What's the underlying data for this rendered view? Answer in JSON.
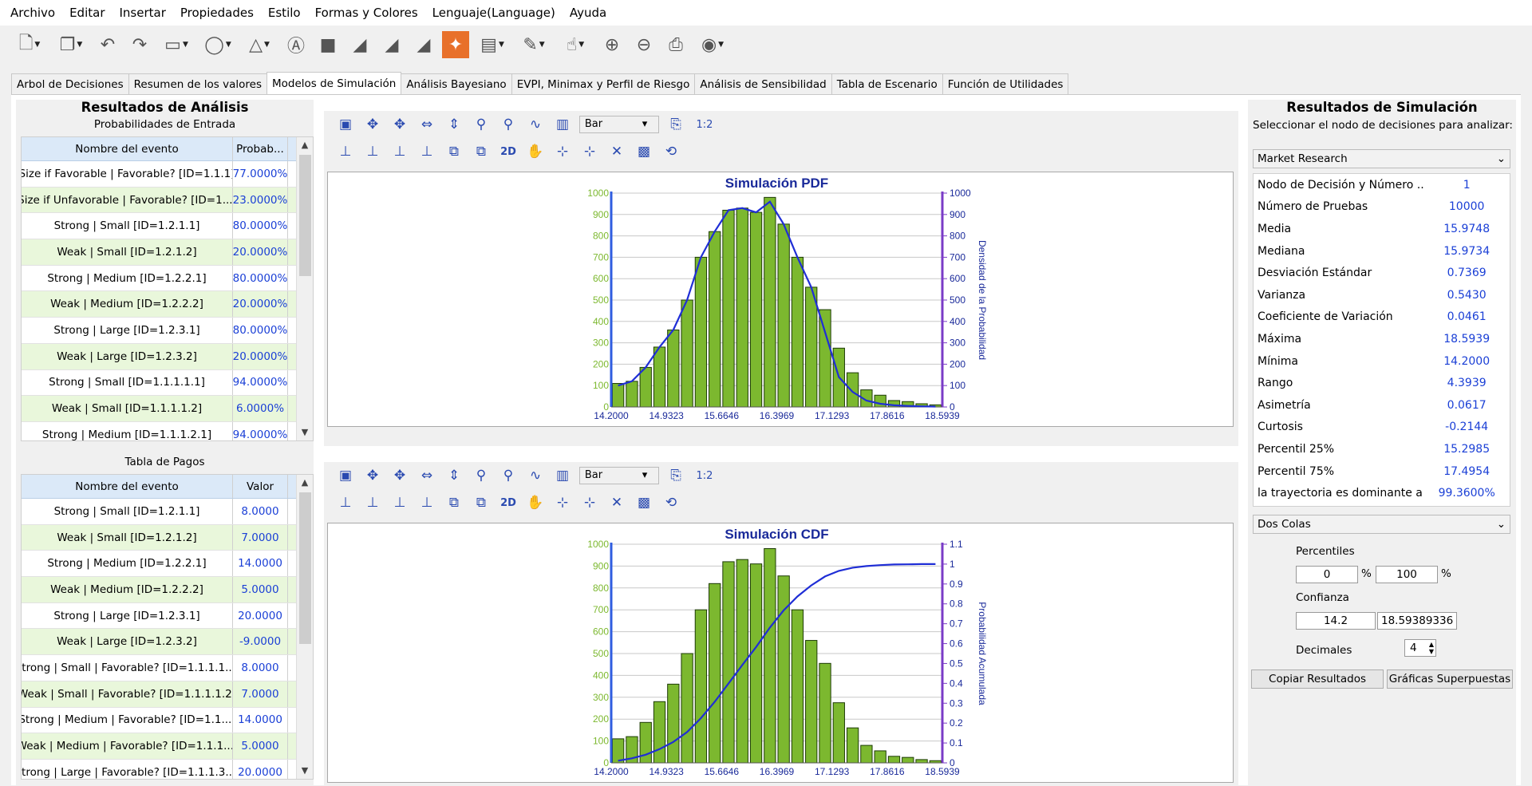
{
  "menu": [
    "Archivo",
    "Editar",
    "Insertar",
    "Propiedades",
    "Estilo",
    "Formas y Colores",
    "Lenguaje(Language)",
    "Ayuda"
  ],
  "toolbar_icons": [
    "new-file-icon",
    "copy-icon",
    "undo-icon",
    "redo-icon",
    "rectangle-icon",
    "ellipse-icon",
    "triangle-icon",
    "text-box-icon",
    "fill-icon",
    "chart-icon",
    "chart-icon",
    "chart-icon",
    "simulation-icon",
    "calculator-icon",
    "edit-icon",
    "pointer-icon",
    "zoom-in-icon",
    "zoom-out-icon",
    "print-icon",
    "palette-icon"
  ],
  "tabs": [
    "Arbol de Decisiones",
    "Resumen de los valores",
    "Modelos de Simulación",
    "Análisis Bayesiano",
    "EVPI, Minimax y Perfil de Riesgo",
    "Análisis de Sensibilidad",
    "Tabla de Escenario",
    "Función de Utilidades"
  ],
  "active_tab": 2,
  "left": {
    "title": "Resultados de Análisis",
    "prob_title": "Probabilidades de Entrada",
    "prob_headers": [
      "Nombre del evento",
      "Probab..."
    ],
    "prob_rows": [
      [
        "Size if Favorable | Favorable? [ID=1.1.1]",
        "77.0000%"
      ],
      [
        "Size if Unfavorable | Favorable? [ID=1....",
        "23.0000%"
      ],
      [
        "Strong | Small [ID=1.2.1.1]",
        "80.0000%"
      ],
      [
        "Weak | Small [ID=1.2.1.2]",
        "20.0000%"
      ],
      [
        "Strong | Medium [ID=1.2.2.1]",
        "80.0000%"
      ],
      [
        "Weak | Medium [ID=1.2.2.2]",
        "20.0000%"
      ],
      [
        "Strong | Large [ID=1.2.3.1]",
        "80.0000%"
      ],
      [
        "Weak | Large [ID=1.2.3.2]",
        "20.0000%"
      ],
      [
        "Strong | Small [ID=1.1.1.1.1]",
        "94.0000%"
      ],
      [
        "Weak | Small [ID=1.1.1.1.2]",
        "6.0000%"
      ],
      [
        "Strong | Medium [ID=1.1.1.2.1]",
        "94.0000%"
      ]
    ],
    "pay_title": "Tabla de Pagos",
    "pay_headers": [
      "Nombre del evento",
      "Valor"
    ],
    "pay_rows": [
      [
        "Strong | Small [ID=1.2.1.1]",
        "8.0000"
      ],
      [
        "Weak | Small [ID=1.2.1.2]",
        "7.0000"
      ],
      [
        "Strong | Medium [ID=1.2.2.1]",
        "14.0000"
      ],
      [
        "Weak | Medium [ID=1.2.2.2]",
        "5.0000"
      ],
      [
        "Strong | Large [ID=1.2.3.1]",
        "20.0000"
      ],
      [
        "Weak | Large [ID=1.2.3.2]",
        "-9.0000"
      ],
      [
        "Strong | Small | Favorable? [ID=1.1.1.1....",
        "8.0000"
      ],
      [
        "Weak | Small | Favorable? [ID=1.1.1.1.2]",
        "7.0000"
      ],
      [
        "Strong | Medium | Favorable? [ID=1.1....",
        "14.0000"
      ],
      [
        "Weak | Medium | Favorable? [ID=1.1.1....",
        "5.0000"
      ],
      [
        "Strong | Large | Favorable? [ID=1.1.1.3....",
        "20.0000"
      ]
    ]
  },
  "chart_toolbar": {
    "type_select": "Bar",
    "mode_2d": "2D",
    "num_label": "1:2"
  },
  "right": {
    "title": "Resultados de Simulación",
    "prompt": "Seleccionar el nodo de decisiones para analizar:",
    "node_select": "Market Research",
    "stats": [
      [
        "Nodo de Decisión y Número ...",
        "1"
      ],
      [
        "Número de Pruebas",
        "10000"
      ],
      [
        "Media",
        "15.9748"
      ],
      [
        "Mediana",
        "15.9734"
      ],
      [
        "Desviación Estándar",
        "0.7369"
      ],
      [
        "Varianza",
        "0.5430"
      ],
      [
        "Coeficiente de Variación",
        "0.0461"
      ],
      [
        "Máxima",
        "18.5939"
      ],
      [
        "Mínima",
        "14.2000"
      ],
      [
        "Rango",
        "4.3939"
      ],
      [
        "Asimetría",
        "0.0617"
      ],
      [
        "Curtosis",
        "-0.2144"
      ],
      [
        "Percentil 25%",
        "15.2985"
      ],
      [
        "Percentil 75%",
        "17.4954"
      ],
      [
        "la trayectoria es dominante al...",
        "99.3600%"
      ]
    ],
    "tails_select": "Dos Colas",
    "percentiles_label": "Percentiles",
    "pct_low": "0",
    "pct_high": "100",
    "pct_sign": "%",
    "confianza_label": "Confianza",
    "conf_low": "14.2",
    "conf_high": "18.59389336",
    "decimales_label": "Decimales",
    "decimales": "4",
    "copy_button": "Copiar Resultados",
    "overlay_button": "Gráficas Superpuestas"
  },
  "chart_data": [
    {
      "type": "bar",
      "title": "Simulación PDF",
      "xlabel": "",
      "ylabel": "",
      "y2label": "Densidad de la Probabilidad",
      "x_ticks": [
        "14.2000",
        "14.9323",
        "15.6646",
        "16.3969",
        "17.1293",
        "17.8616",
        "18.5939"
      ],
      "y_ticks": [
        "0",
        "100",
        "200",
        "300",
        "400",
        "500",
        "600",
        "700",
        "800",
        "900",
        "1000"
      ],
      "y2_ticks": [
        "0",
        "100",
        "200",
        "300",
        "400",
        "500",
        "600",
        "700",
        "800",
        "900",
        "1000"
      ],
      "ylim": [
        0,
        1000
      ],
      "y2lim": [
        0,
        1000
      ],
      "values": [
        110,
        120,
        185,
        280,
        360,
        500,
        700,
        820,
        920,
        930,
        910,
        980,
        855,
        700,
        560,
        455,
        275,
        160,
        80,
        55,
        30,
        25,
        15,
        10
      ],
      "line": [
        100,
        120,
        185,
        280,
        360,
        500,
        700,
        820,
        920,
        930,
        910,
        960,
        855,
        700,
        560,
        350,
        140,
        70,
        30,
        15,
        8,
        5,
        3,
        2
      ],
      "grid": true,
      "bar_color": "#7cb82f",
      "line_color": "#1f2ed6"
    },
    {
      "type": "bar",
      "title": "Simulación CDF",
      "xlabel": "",
      "ylabel": "",
      "y2label": "Probabilidad Acumulada",
      "x_ticks": [
        "14.2000",
        "14.9323",
        "15.6646",
        "16.3969",
        "17.1293",
        "17.8616",
        "18.5939"
      ],
      "y_ticks": [
        "0",
        "100",
        "200",
        "300",
        "400",
        "500",
        "600",
        "700",
        "800",
        "900",
        "1000"
      ],
      "y2_ticks": [
        "0",
        "0.1",
        "0.2",
        "0.3",
        "0.4",
        "0.5",
        "0.6",
        "0.7",
        "0.8",
        "0.9",
        "1",
        "1.1"
      ],
      "ylim": [
        0,
        1000
      ],
      "y2lim": [
        0,
        1.1
      ],
      "values": [
        110,
        120,
        185,
        280,
        360,
        500,
        700,
        820,
        920,
        930,
        910,
        980,
        855,
        700,
        560,
        455,
        275,
        160,
        80,
        55,
        30,
        25,
        15,
        10
      ],
      "line": [
        0.011,
        0.023,
        0.041,
        0.069,
        0.105,
        0.155,
        0.225,
        0.307,
        0.399,
        0.492,
        0.583,
        0.681,
        0.767,
        0.837,
        0.893,
        0.938,
        0.966,
        0.982,
        0.99,
        0.995,
        0.998,
        0.999,
        1.0,
        1.0
      ],
      "grid": true,
      "bar_color": "#7cb82f",
      "line_color": "#1f2ed6"
    }
  ]
}
